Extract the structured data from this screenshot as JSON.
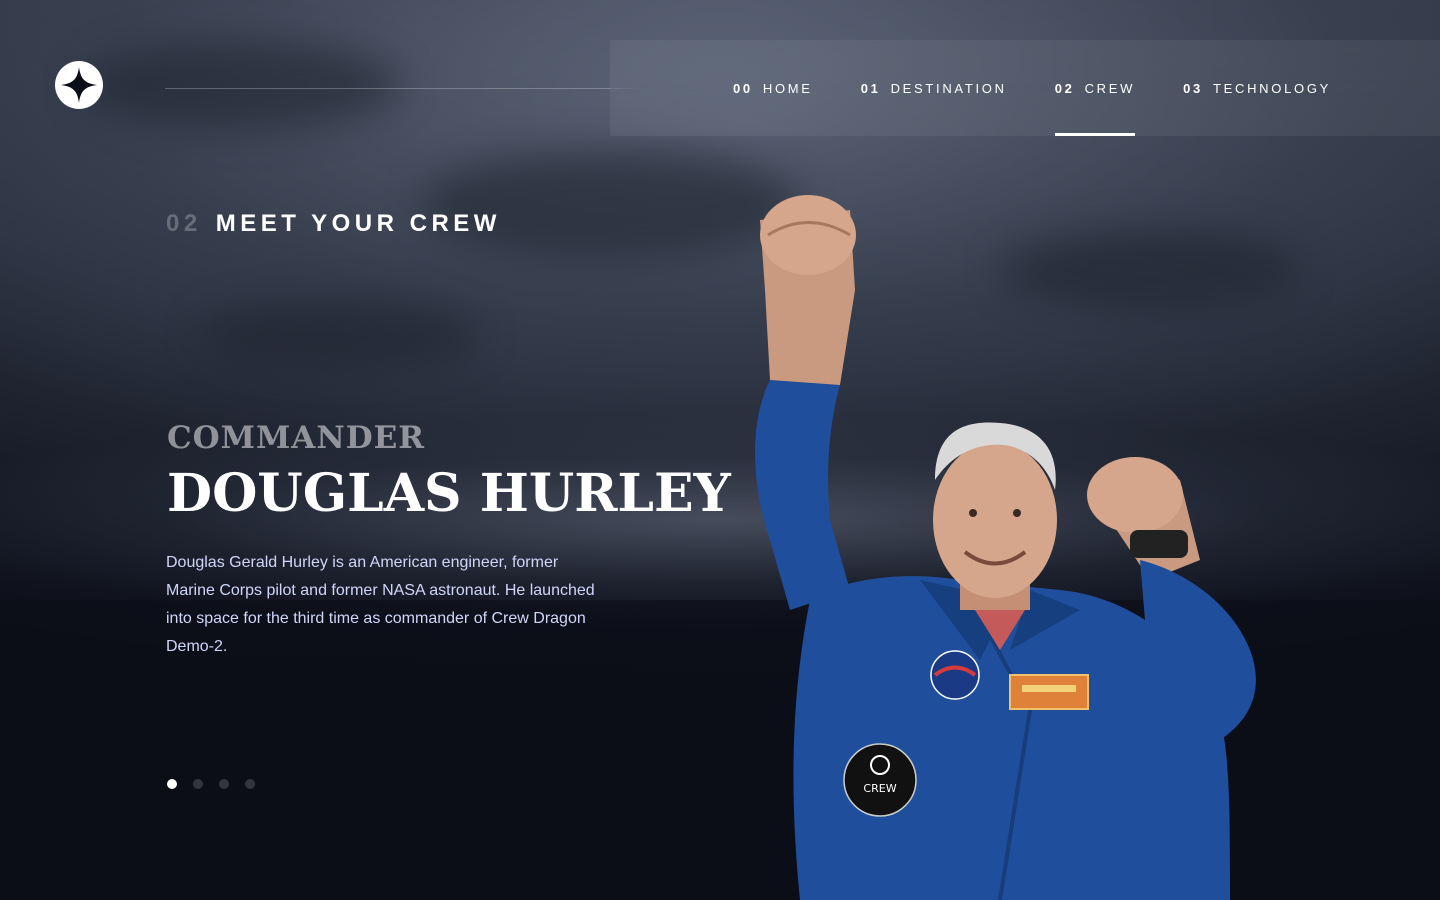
{
  "nav": {
    "items": [
      {
        "num": "00",
        "label": "HOME"
      },
      {
        "num": "01",
        "label": "DESTINATION"
      },
      {
        "num": "02",
        "label": "CREW",
        "active": true
      },
      {
        "num": "03",
        "label": "TECHNOLOGY"
      }
    ]
  },
  "page": {
    "heading_num": "02",
    "heading": "MEET YOUR CREW"
  },
  "crew": {
    "role": "COMMANDER",
    "name": "DOUGLAS HURLEY",
    "bio": "Douglas Gerald Hurley is an American engineer, former Marine Corps pilot and former NASA astronaut. He launched into space for the third time as commander of Crew Dragon Demo-2.",
    "patch_text": "CREW"
  },
  "slider": {
    "total": 4,
    "active_index": 0
  },
  "colors": {
    "background": "#0b0d17",
    "text_light": "#d0d6f9",
    "white": "#ffffff",
    "suit_blue": "#1f4f9c"
  },
  "icons": {
    "logo": "star-logo-icon"
  }
}
